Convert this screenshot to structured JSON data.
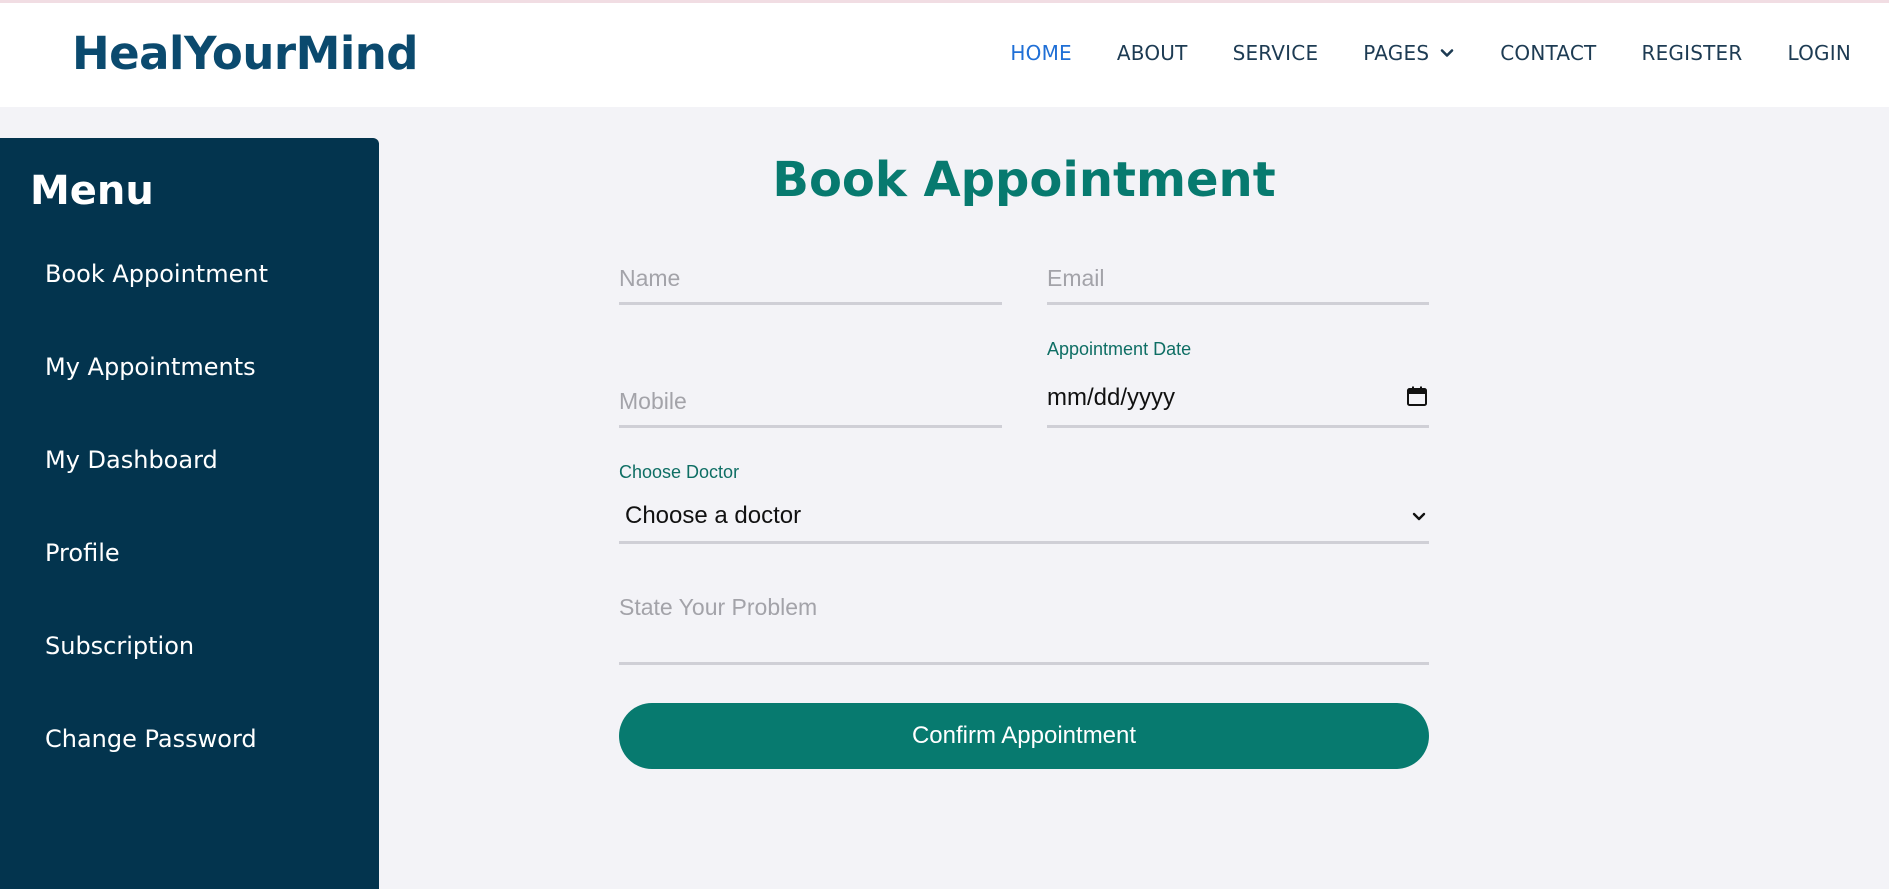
{
  "brand": "HealYourMind",
  "nav": {
    "items": [
      {
        "label": "HOME",
        "active": true
      },
      {
        "label": "ABOUT"
      },
      {
        "label": "SERVICE"
      },
      {
        "label": "PAGES",
        "has_dropdown": true
      },
      {
        "label": "CONTACT"
      },
      {
        "label": "REGISTER"
      },
      {
        "label": "LOGIN"
      }
    ]
  },
  "sidebar": {
    "title": "Menu",
    "items": [
      {
        "label": "Book Appointment"
      },
      {
        "label": "My Appointments"
      },
      {
        "label": "My Dashboard"
      },
      {
        "label": "Profile"
      },
      {
        "label": "Subscription"
      },
      {
        "label": "Change Password"
      }
    ]
  },
  "form": {
    "title": "Book Appointment",
    "name": {
      "placeholder": "Name",
      "value": ""
    },
    "email": {
      "placeholder": "Email",
      "value": ""
    },
    "mobile": {
      "placeholder": "Mobile",
      "value": ""
    },
    "date": {
      "label": "Appointment Date",
      "value": "mm/dd/yyyy"
    },
    "doctor": {
      "label": "Choose Doctor",
      "selected": "Choose a doctor"
    },
    "problem": {
      "placeholder": "State Your Problem",
      "value": ""
    },
    "confirm_label": "Confirm Appointment"
  },
  "colors": {
    "brand": "#0b4a6e",
    "nav_active": "#1f6fd6",
    "sidebar_bg": "#03344e",
    "accent": "#077a6f",
    "page_bg": "#f3f3f7"
  },
  "icons": {
    "pages_dropdown": "chevron-down-icon",
    "date": "calendar-icon",
    "doctor_select": "chevron-down-icon"
  }
}
